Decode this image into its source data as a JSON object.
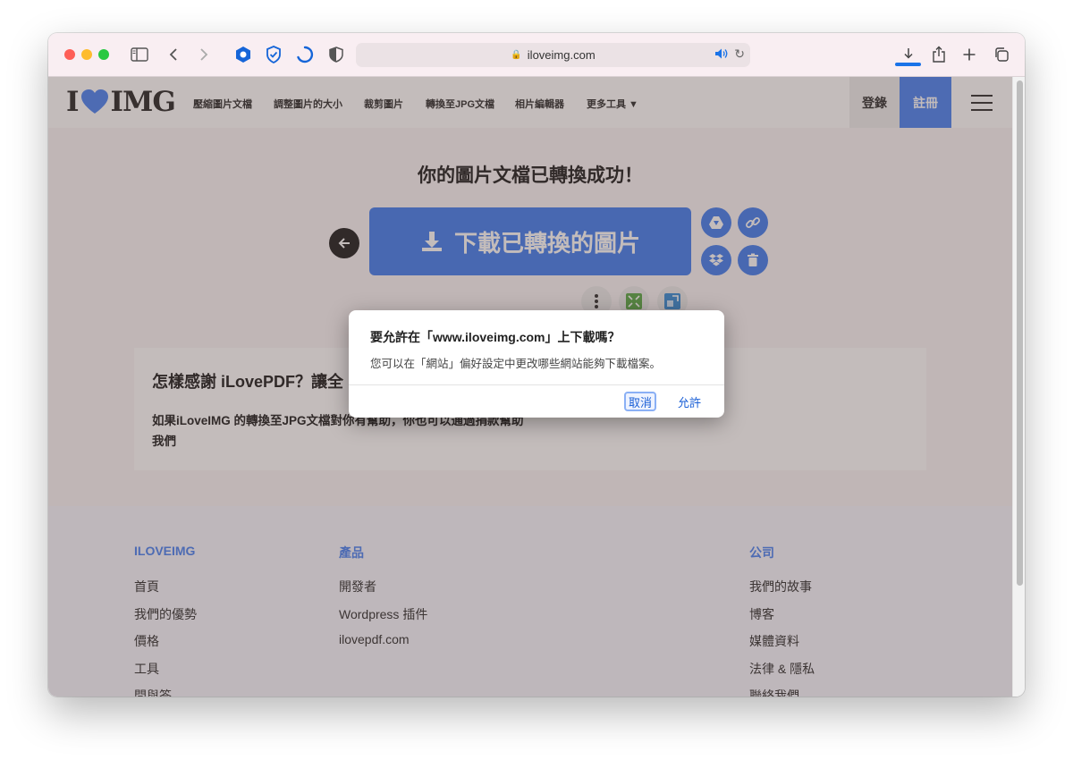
{
  "browser": {
    "url": "iloveimg.com"
  },
  "nav": {
    "logo_left": "I",
    "logo_right": "IMG",
    "items": [
      "壓縮圖片文檔",
      "調整圖片的大小",
      "裁剪圖片",
      "轉換至JPG文檔",
      "相片編輯器",
      "更多工具 ▼"
    ],
    "login": "登錄",
    "signup": "註冊"
  },
  "main": {
    "success_title": "你的圖片文檔已轉換成功！",
    "download_button": "下載已轉換的圖片",
    "donate_title": "怎樣感謝 iLovePDF？讓全",
    "donate_text": "如果iLoveIMG 的轉換至JPG文檔對你有幫助，你也可以通過捐款幫助我們"
  },
  "footer": {
    "columns": [
      {
        "heading": "ILOVEIMG",
        "links": [
          "首頁",
          "我們的優勢",
          "價格",
          "工具",
          "問與答"
        ]
      },
      {
        "heading": "產品",
        "links": [
          "開發者",
          "Wordpress 插件",
          "ilovepdf.com"
        ]
      },
      {
        "heading": "公司",
        "links": [
          "我們的故事",
          "博客",
          "媒體資料",
          "法律 & 隱私",
          "聯絡我們"
        ]
      }
    ]
  },
  "dialog": {
    "title": "要允許在「www.iloveimg.com」上下載嗎？",
    "message": "您可以在「網站」偏好設定中更改哪些網站能夠下載檔案。",
    "cancel": "取消",
    "allow": "允許"
  },
  "colors": {
    "accent": "#4580f0",
    "brand_blue": "#4d85f3",
    "heart": "#4d85f3"
  }
}
